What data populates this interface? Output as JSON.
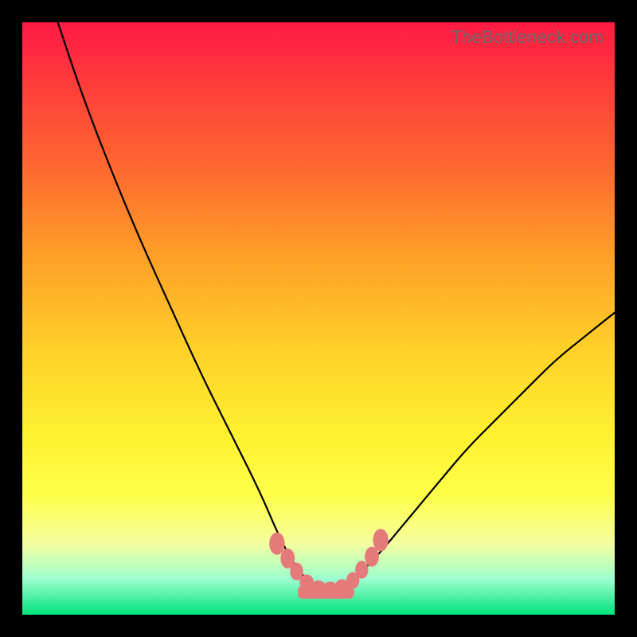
{
  "watermark": "TheBottleneck.com",
  "chart_data": {
    "type": "line",
    "title": "",
    "xlabel": "",
    "ylabel": "",
    "xlim": [
      0,
      100
    ],
    "ylim": [
      0,
      100
    ],
    "grid": false,
    "series": [
      {
        "name": "bottleneck-curve",
        "x": [
          6,
          10,
          15,
          20,
          25,
          30,
          35,
          40,
          43,
          45,
          47,
          49,
          51,
          53,
          55,
          57,
          60,
          65,
          70,
          75,
          80,
          85,
          90,
          95,
          100
        ],
        "y": [
          100,
          88,
          75,
          63,
          52,
          41,
          31,
          21,
          14,
          10,
          7,
          5,
          4,
          4,
          5,
          7,
          10,
          16,
          22,
          28,
          33,
          38,
          43,
          47,
          51
        ]
      }
    ],
    "markers": {
      "name": "highlighted-points",
      "color": "#e47a7a",
      "points": [
        {
          "x": 43.0,
          "y": 12.0,
          "w": 2.6,
          "h": 3.8
        },
        {
          "x": 44.8,
          "y": 9.5,
          "w": 2.4,
          "h": 3.4
        },
        {
          "x": 46.3,
          "y": 7.3,
          "w": 2.2,
          "h": 3.0
        },
        {
          "x": 48.0,
          "y": 5.5,
          "w": 2.4,
          "h": 2.6
        },
        {
          "x": 50.0,
          "y": 4.6,
          "w": 2.6,
          "h": 2.4
        },
        {
          "x": 52.0,
          "y": 4.4,
          "w": 2.6,
          "h": 2.4
        },
        {
          "x": 54.0,
          "y": 4.8,
          "w": 2.4,
          "h": 2.4
        },
        {
          "x": 55.8,
          "y": 5.8,
          "w": 2.2,
          "h": 2.8
        },
        {
          "x": 57.3,
          "y": 7.6,
          "w": 2.2,
          "h": 3.0
        },
        {
          "x": 59.0,
          "y": 9.8,
          "w": 2.4,
          "h": 3.4
        },
        {
          "x": 60.5,
          "y": 12.6,
          "w": 2.6,
          "h": 3.8
        }
      ]
    },
    "bottom_band": {
      "name": "floor-bar",
      "color": "#e47a7a",
      "x0": 46.5,
      "x1": 56.0,
      "y": 3.8,
      "h": 2.2
    }
  }
}
